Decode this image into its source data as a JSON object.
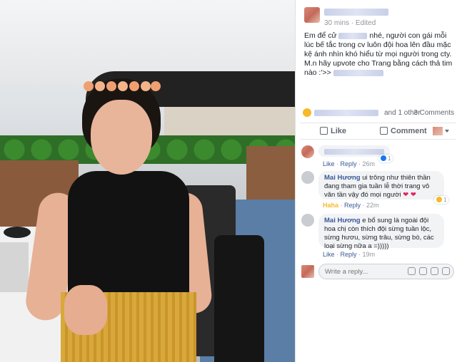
{
  "post": {
    "time": "30 mins",
    "edited": "Edited",
    "text_part1": "Em để cử ",
    "text_part2": " nhé, người con gái mỗi lúc bế tắc trong cv luôn đội hoa lên đầu mặc kệ ánh nhìn khó hiểu từ mọi người trong cty. M.n hãy upvote cho Trang bằng cách thả tim nào :'>> ",
    "reactions_other": "and 1 other",
    "comments_count": "3 Comments"
  },
  "actions": {
    "like": "Like",
    "comment": "Comment"
  },
  "comments": [
    {
      "like": "Like",
      "reply": "Reply",
      "time": "26m",
      "reaction_count": "1"
    },
    {
      "author": "Mai Hương",
      "text": "ui trông như thiên thần đang tham gia tuần lễ thời trang vô văn tần vậy đó mọi người",
      "hearts": "❤ ❤",
      "haha": "Haha",
      "reply": "Reply",
      "time": "22m",
      "reaction_count": "1"
    },
    {
      "author": "Mai Hương",
      "text": "e bổ sung là ngoài đội hoa chị còn thích đội sừng tuần lộc, sừng hươu, sừng trâu, sừng bò, các loại sừng nữa a =)))))",
      "like": "Like",
      "reply": "Reply",
      "time": "19m"
    }
  ],
  "reply_box": {
    "placeholder": "Write a reply..."
  },
  "colors": {
    "link": "#385898",
    "meta": "#90949c",
    "bubble": "#f2f3f5",
    "haha": "#f7b928"
  }
}
